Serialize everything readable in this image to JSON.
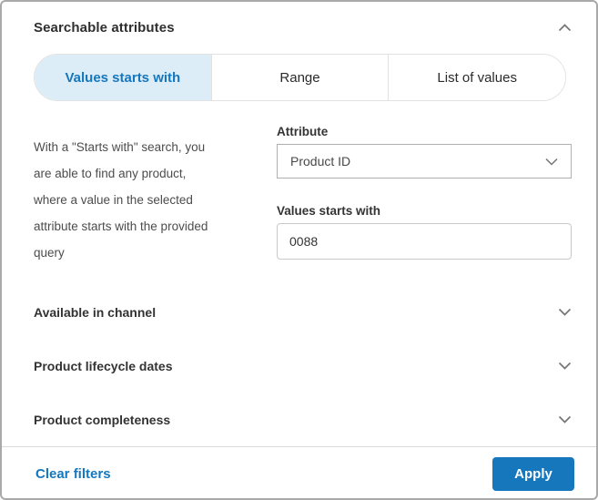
{
  "panel": {
    "title": "Searchable attributes",
    "collapse_icon": "chevron-up-icon"
  },
  "tabs": [
    {
      "label": "Values starts with",
      "active": true
    },
    {
      "label": "Range",
      "active": false
    },
    {
      "label": "List of values",
      "active": false
    }
  ],
  "description": {
    "full_text": "With a \"Starts with\" search, you are able to find any product, where a value in the selected attribute starts with the provided query",
    "lines": [
      "With a \"Starts with\" search, you",
      "are able to find any product,",
      "where a value in the selected",
      "attribute starts with the provided",
      "query"
    ]
  },
  "form": {
    "attribute_label": "Attribute",
    "attribute_value": "Product ID",
    "starts_with_label": "Values starts with",
    "starts_with_value": "0088"
  },
  "sections": [
    {
      "label": "Available in channel",
      "state_icon": "chevron-down-icon"
    },
    {
      "label": "Product lifecycle dates",
      "state_icon": "chevron-down-icon"
    },
    {
      "label": "Product completeness",
      "state_icon": "chevron-down-icon"
    }
  ],
  "footer": {
    "clear_label": "Clear filters",
    "apply_label": "Apply"
  },
  "colors": {
    "accent_blue": "#1577bd",
    "active_tab_bg": "#ddedf7",
    "panel_border": "#a9a9a9",
    "chevron_gray": "#757575"
  }
}
